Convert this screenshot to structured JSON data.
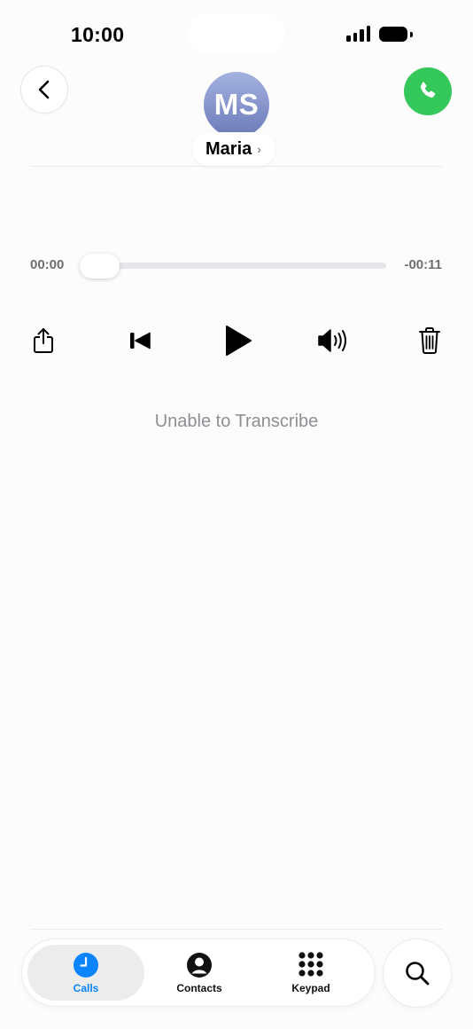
{
  "status_bar": {
    "time": "10:00"
  },
  "header": {
    "avatar_initials": "MS",
    "contact_name": "Maria",
    "name_chevron": "›",
    "back_icon": "chevron-left-icon",
    "call_icon": "phone-icon",
    "call_button_color": "#34c759",
    "avatar_gradient": [
      "#a4b2e0",
      "#6c7ab9"
    ]
  },
  "player": {
    "elapsed": "00:00",
    "remaining": "-00:11",
    "progress": 0,
    "controls": [
      "share-icon",
      "skip-back-icon",
      "play-icon",
      "speaker-icon",
      "trash-icon"
    ]
  },
  "transcription": {
    "status": "Unable to Transcribe"
  },
  "tab_bar": {
    "tabs": [
      {
        "label": "Calls",
        "icon": "clock-icon",
        "active": true
      },
      {
        "label": "Contacts",
        "icon": "person-icon",
        "active": false
      },
      {
        "label": "Keypad",
        "icon": "keypad-icon",
        "active": false
      }
    ],
    "search_icon": "search-icon",
    "active_color": "#0a84ff"
  }
}
